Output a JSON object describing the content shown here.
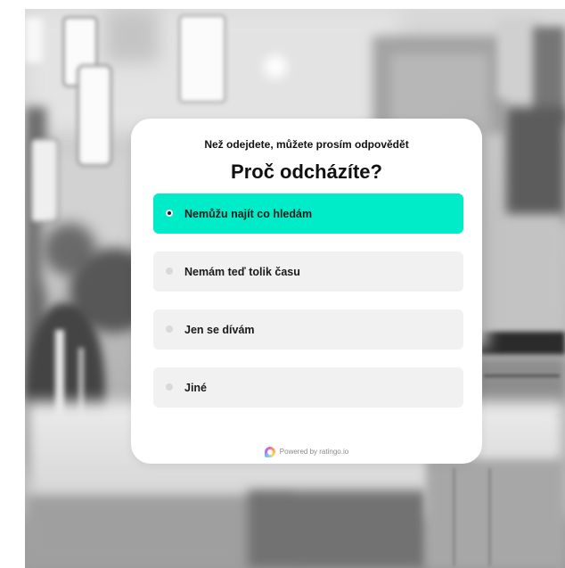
{
  "survey": {
    "subtitle": "Než odejdete, můžete prosím odpovědět",
    "title": "Proč odcházíte?",
    "options": [
      {
        "label": "Nemůžu najít co hledám",
        "selected": true
      },
      {
        "label": "Nemám teď tolik času",
        "selected": false
      },
      {
        "label": "Jen se dívám",
        "selected": false
      },
      {
        "label": "Jiné",
        "selected": false
      }
    ],
    "footer": {
      "powered_by": "Powered by ratingo.io",
      "logo_icon": "ratingo-logo-icon"
    }
  },
  "colors": {
    "accent": "#00ebc7",
    "option_bg": "#f1f1f1",
    "card_bg": "#ffffff",
    "text": "#111111",
    "muted_text": "#8a8a8a",
    "radio_idle": "#d9d9d9"
  }
}
